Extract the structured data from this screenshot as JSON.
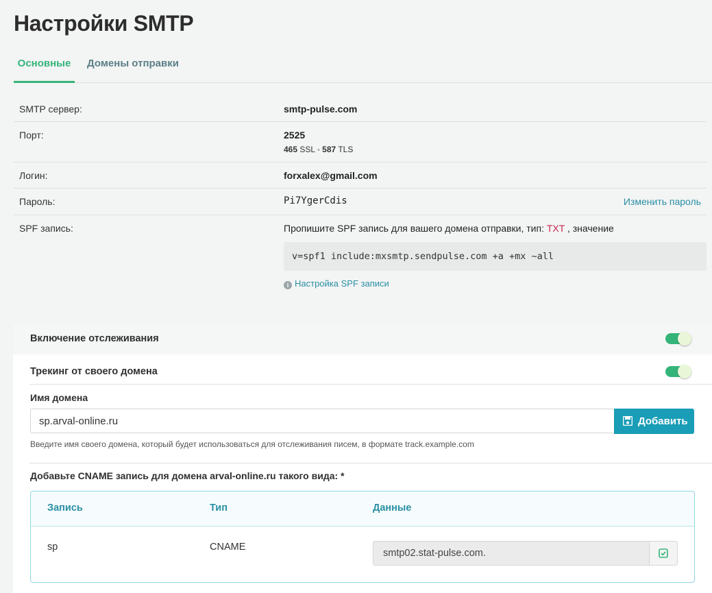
{
  "page_title": "Настройки SMTP",
  "tabs": [
    {
      "label": "Основные",
      "active": true
    },
    {
      "label": "Домены отправки",
      "active": false
    }
  ],
  "settings": {
    "server": {
      "label": "SMTP сервер:",
      "value": "smtp-pulse.com"
    },
    "port": {
      "label": "Порт:",
      "value": "2525",
      "alt1_num": "465",
      "alt1_proto": "SSL",
      "separator": "•",
      "alt2_num": "587",
      "alt2_proto": "TLS"
    },
    "login": {
      "label": "Логин:",
      "value": "forxalex@gmail.com"
    },
    "password": {
      "label": "Пароль:",
      "value": "Pi7YgerCdis",
      "change_link": "Изменить пароль"
    },
    "spf": {
      "label": "SPF запись:",
      "instruction_prefix": "Пропишите SPF запись для вашего домена отправки, тип:",
      "type": "TXT",
      "instruction_suffix": ", значение",
      "record": "v=spf1 include:mxsmtp.sendpulse.com +a +mx ~all",
      "help_link": "Настройка SPF записи"
    }
  },
  "tracking": {
    "enable_label": "Включение отслеживания",
    "enable_on": true,
    "own_domain_label": "Трекинг от своего домена",
    "own_domain_on": true,
    "domain_name_label": "Имя домена",
    "domain_input_value": "sp.arval-online.ru",
    "add_button": "Добавить",
    "hint": "Введите имя своего домена, который будет использоваться для отслеживания писем, в формате track.example.com",
    "cname_title": "Добавьте CNAME запись для домена arval-online.ru такого вида: *",
    "table": {
      "headers": [
        "Запись",
        "Тип",
        "Данные"
      ],
      "row": {
        "record": "sp",
        "type": "CNAME",
        "data": "smtp02.stat-pulse.com."
      }
    }
  },
  "colors": {
    "accent_green": "#35b47a",
    "accent_blue": "#1a9db6",
    "link": "#2a8fa5",
    "txt_red": "#c7254e"
  }
}
